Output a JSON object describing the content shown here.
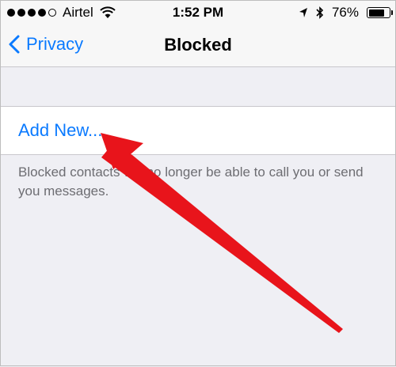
{
  "status_bar": {
    "signal_icon": "signal-dots-icon",
    "carrier": "Airtel",
    "wifi_icon": "wifi-icon",
    "time": "1:52 PM",
    "location_icon": "location-arrow-icon",
    "bluetooth_icon": "bluetooth-icon",
    "battery_percent": "76%",
    "battery_level": 0.76
  },
  "nav": {
    "back_label": "Privacy",
    "title": "Blocked"
  },
  "blocked_list": {
    "add_new_label": "Add New...",
    "footer": "Blocked contacts will no longer be able to call you or send you messages."
  },
  "colors": {
    "accent": "#0a7aff",
    "annotation_arrow": "#e8141b",
    "background": "#efeff4"
  }
}
